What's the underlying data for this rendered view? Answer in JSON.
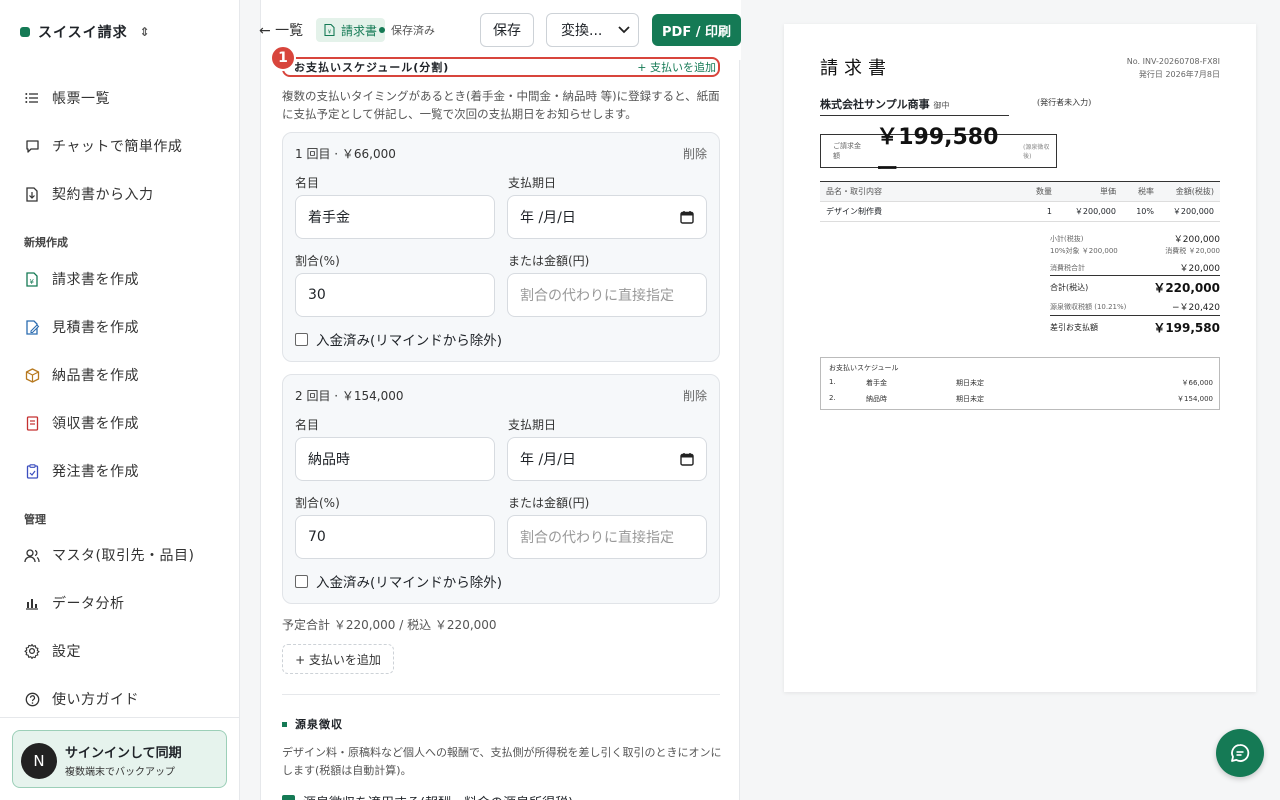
{
  "sidebar": {
    "brand": "スイスイ請求",
    "items": [
      {
        "label": "帳票一覧",
        "icon": "list-icon"
      },
      {
        "label": "チャットで簡単作成",
        "icon": "chat-icon"
      },
      {
        "label": "契約書から入力",
        "icon": "file-import-icon"
      }
    ],
    "section_new": "新規作成",
    "create_items": [
      {
        "label": "請求書を作成",
        "icon": "invoice-icon",
        "color": "#157a55"
      },
      {
        "label": "見積書を作成",
        "icon": "quote-icon",
        "color": "#2b6cb0"
      },
      {
        "label": "納品書を作成",
        "icon": "box-icon",
        "color": "#b7791f"
      },
      {
        "label": "領収書を作成",
        "icon": "receipt-icon",
        "color": "#c53030"
      },
      {
        "label": "発注書を作成",
        "icon": "order-icon",
        "color": "#3c4fbf"
      }
    ],
    "section_manage": "管理",
    "manage_items": [
      {
        "label": "マスタ(取引先・品目)",
        "icon": "users-icon"
      },
      {
        "label": "データ分析",
        "icon": "bar-chart-icon"
      },
      {
        "label": "設定",
        "icon": "gear-icon"
      },
      {
        "label": "使い方ガイド",
        "icon": "help-icon"
      }
    ],
    "signin": {
      "avatar": "N",
      "title": "サインインして同期",
      "subtitle": "複数端末でバックアップ"
    }
  },
  "toolbar": {
    "back": "← 一覧",
    "doc_type": "請求書",
    "status": "保存済み",
    "save": "保存",
    "convert": "変換...",
    "pdf": "PDF / 印刷"
  },
  "schedule": {
    "badge": "1",
    "title": "お支払いスケジュール(分割)",
    "add_link": "+ 支払いを追加",
    "description": "複数の支払いタイミングがあるとき(着手金・中間金・納品時 等)に登録すると、紙面に支払予定として併記し、一覧で次回の支払期日をお知らせします。",
    "field_labels": {
      "name": "名目",
      "due": "支払期日",
      "ratio": "割合(%)",
      "amount": "または金額(円)"
    },
    "amount_placeholder": "割合の代わりに直接指定",
    "date_placeholder": "年 /月/日",
    "delete": "削除",
    "paid_label": "入金済み(リマインドから除外)",
    "payments": [
      {
        "header": "1 回目 · ￥66,000",
        "name": "着手金",
        "ratio": "30"
      },
      {
        "header": "2 回目 · ￥154,000",
        "name": "納品時",
        "ratio": "70"
      }
    ],
    "total": "予定合計 ￥220,000 / 税込 ￥220,000",
    "add_button": "+ 支払いを追加"
  },
  "withholding": {
    "title": "源泉徴収",
    "description": "デザイン料・原稿料など個人への報酬で、支払側が所得税を差し引く取引のときにオンにします(税額は自動計算)。",
    "checkbox": "源泉徴収を適用する(報酬・料金の源泉所得税)"
  },
  "preview": {
    "title": "請求書",
    "number": "No. INV-20260708-FX8I",
    "issue_date": "発行日 2026年7月8日",
    "client": "株式会社サンプル商事",
    "client_suffix": "御中",
    "issuer": "(発行者未入力)",
    "total_label": "ご請求金額",
    "total_value": "￥199,580ー",
    "total_note": "(源泉徴収後)",
    "table_headers": [
      "品名・取引内容",
      "数量",
      "単価",
      "税率",
      "金額(税抜)"
    ],
    "table_rows": [
      [
        "デザイン制作費",
        "1",
        "￥200,000",
        "10%",
        "￥200,000"
      ]
    ],
    "summary": {
      "subtotal_label": "小計(税抜)",
      "subtotal": "￥200,000",
      "tax_target_label": "10%対象 ￥200,000",
      "tax_label": "消費税 ￥20,000",
      "tax_total_label": "消費税合計",
      "tax_total": "￥20,000",
      "total_label": "合計(税込)",
      "total": "￥220,000",
      "withholding_label": "源泉徴収税額 (10.21%)",
      "withholding": "−￥20,420",
      "net_label": "差引お支払額",
      "net": "￥199,580"
    },
    "schedule_title": "お支払いスケジュール",
    "schedule_rows": [
      [
        "1.",
        "着手金",
        "期日未定",
        "￥66,000"
      ],
      [
        "2.",
        "納品時",
        "期日未定",
        "￥154,000"
      ]
    ]
  },
  "colors": {
    "brand": "#157a55",
    "highlight": "#d8453c"
  }
}
